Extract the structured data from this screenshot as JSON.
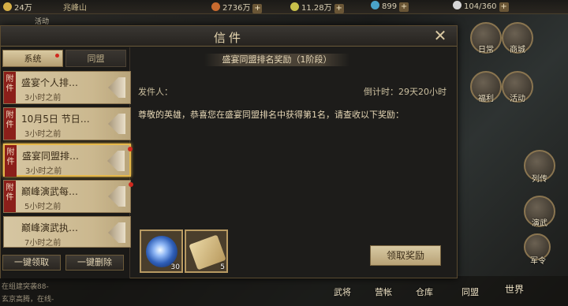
{
  "hud": {
    "res_left": "24万",
    "res_name": "兆峰山",
    "res1": "2736万",
    "res2": "11.28万",
    "res3": "899",
    "res4": "104/360",
    "plus": "+",
    "left_btn": "活动"
  },
  "side_buttons": [
    "日常",
    "商城",
    "福利",
    "活动",
    "列传",
    "演武",
    "军令"
  ],
  "bottom_buttons": [
    "武将",
    "营帐",
    "仓库",
    "同盟",
    "世界"
  ],
  "chat": [
    "在组建突袭88-",
    "玄京高腾，在线-"
  ],
  "modal": {
    "title": "信件",
    "close": "✕"
  },
  "tabs": {
    "active": "系统",
    "inactive": "同盟"
  },
  "mail_list": [
    {
      "tag": "附件",
      "title": "盛宴个人排…",
      "time": "3小时之前",
      "selected": false,
      "unread": false
    },
    {
      "tag": "附件",
      "title": "10月5日 节日…",
      "time": "3小时之前",
      "selected": false,
      "unread": false
    },
    {
      "tag": "附件",
      "title": "盛宴同盟排…",
      "time": "3小时之前",
      "selected": true,
      "unread": true
    },
    {
      "tag": "附件",
      "title": "巅峰演武每…",
      "time": "5小时之前",
      "selected": false,
      "unread": true
    },
    {
      "tag": "",
      "title": "巅峰演武执…",
      "time": "7小时之前",
      "selected": false,
      "unread": false
    }
  ],
  "left_buttons": {
    "claim_all": "一键领取",
    "delete_all": "一键删除"
  },
  "mail": {
    "subject": "盛宴同盟排名奖励（1阶段）",
    "sender": "发件人：",
    "countdown": "倒计时：29天20小时",
    "body": "尊敬的英雄，恭喜您在盛宴同盟排名中获得第1名，请查收以下奖励："
  },
  "rewards": [
    {
      "icon": "blue-orb-icon",
      "qty": "30"
    },
    {
      "icon": "scroll-icon",
      "qty": "5"
    }
  ],
  "claim_button": "领取奖励",
  "colors": {
    "accent": "#e6b84a",
    "unread": "#d0281e",
    "tag": "#8b1f1a"
  }
}
